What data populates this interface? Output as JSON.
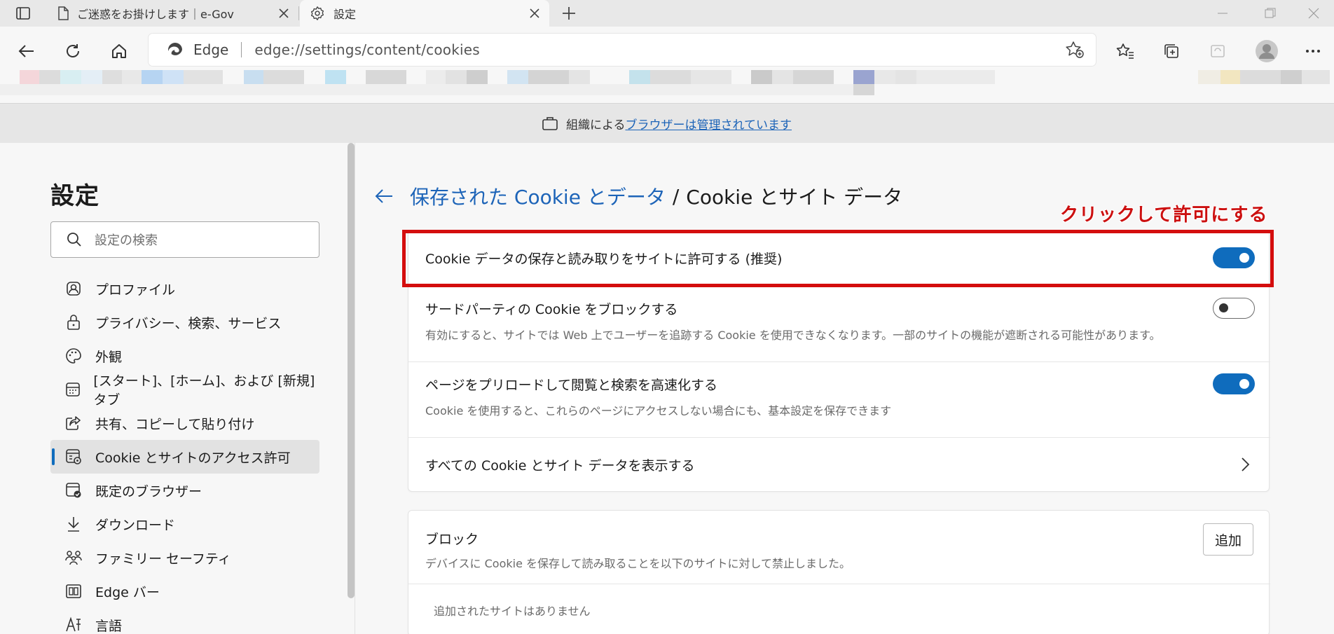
{
  "browser": {
    "tabs": [
      {
        "title": "ご迷惑をお掛けします｜e-Gov",
        "icon": "page-icon"
      },
      {
        "title": "設定",
        "icon": "gear-icon"
      }
    ],
    "address": {
      "brand": "Edge",
      "url": "edge://settings/content/cookies"
    }
  },
  "banner": {
    "prefix": "組織による",
    "link": "ブラウザーは管理されています"
  },
  "sidebar": {
    "title": "設定",
    "search_placeholder": "設定の検索",
    "items": [
      {
        "label": "プロファイル",
        "icon": "profile-icon"
      },
      {
        "label": "プライバシー、検索、サービス",
        "icon": "lock-icon"
      },
      {
        "label": "外観",
        "icon": "palette-icon"
      },
      {
        "label": "[スタート]、[ホーム]、および [新規] タブ",
        "icon": "new-tab-page-icon"
      },
      {
        "label": "共有、コピーして貼り付け",
        "icon": "share-icon"
      },
      {
        "label": "Cookie とサイトのアクセス許可",
        "icon": "site-permissions-icon",
        "active": true
      },
      {
        "label": "既定のブラウザー",
        "icon": "default-browser-icon"
      },
      {
        "label": "ダウンロード",
        "icon": "download-icon"
      },
      {
        "label": "ファミリー セーフティ",
        "icon": "family-icon"
      },
      {
        "label": "Edge バー",
        "icon": "edge-bar-icon"
      },
      {
        "label": "言語",
        "icon": "language-icon"
      }
    ]
  },
  "main": {
    "breadcrumb": {
      "parent": "保存された Cookie とデータ",
      "separator": "/",
      "current": "Cookie とサイト データ"
    },
    "annotation": "クリックして許可にする",
    "settings": [
      {
        "title": "Cookie データの保存と読み取りをサイトに許可する (推奨)",
        "desc": "",
        "toggle": "on"
      },
      {
        "title": "サードパーティの Cookie をブロックする",
        "desc": "有効にすると、サイトでは Web 上でユーザーを追跡する Cookie を使用できなくなります。一部のサイトの機能が遮断される可能性があります。",
        "toggle": "off"
      },
      {
        "title": "ページをプリロードして閲覧と検索を高速化する",
        "desc": "Cookie を使用すると、これらのページにアクセスしない場合にも、基本設定を保存できます",
        "toggle": "on"
      },
      {
        "title": "すべての Cookie とサイト データを表示する",
        "desc": "",
        "toggle": null
      }
    ],
    "block": {
      "title": "ブロック",
      "desc": "デバイスに Cookie を保存して読み取ることを以下のサイトに対して禁止しました。",
      "add_label": "追加",
      "empty": "追加されたサイトはありません"
    }
  },
  "colors": {
    "accent": "#0f6cbd",
    "annotation": "#d40d0d",
    "link": "#1d64b8"
  }
}
